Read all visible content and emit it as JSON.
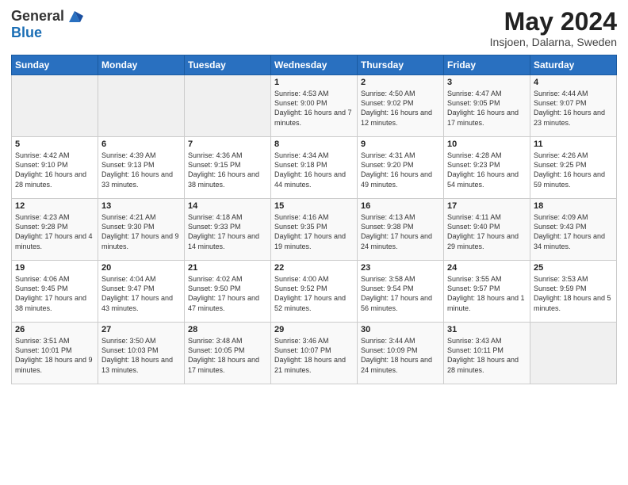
{
  "logo": {
    "line1": "General",
    "line2": "Blue"
  },
  "title": "May 2024",
  "subtitle": "Insjoen, Dalarna, Sweden",
  "weekdays": [
    "Sunday",
    "Monday",
    "Tuesday",
    "Wednesday",
    "Thursday",
    "Friday",
    "Saturday"
  ],
  "weeks": [
    [
      {
        "day": "",
        "info": ""
      },
      {
        "day": "",
        "info": ""
      },
      {
        "day": "",
        "info": ""
      },
      {
        "day": "1",
        "info": "Sunrise: 4:53 AM\nSunset: 9:00 PM\nDaylight: 16 hours\nand 7 minutes."
      },
      {
        "day": "2",
        "info": "Sunrise: 4:50 AM\nSunset: 9:02 PM\nDaylight: 16 hours\nand 12 minutes."
      },
      {
        "day": "3",
        "info": "Sunrise: 4:47 AM\nSunset: 9:05 PM\nDaylight: 16 hours\nand 17 minutes."
      },
      {
        "day": "4",
        "info": "Sunrise: 4:44 AM\nSunset: 9:07 PM\nDaylight: 16 hours\nand 23 minutes."
      }
    ],
    [
      {
        "day": "5",
        "info": "Sunrise: 4:42 AM\nSunset: 9:10 PM\nDaylight: 16 hours\nand 28 minutes."
      },
      {
        "day": "6",
        "info": "Sunrise: 4:39 AM\nSunset: 9:13 PM\nDaylight: 16 hours\nand 33 minutes."
      },
      {
        "day": "7",
        "info": "Sunrise: 4:36 AM\nSunset: 9:15 PM\nDaylight: 16 hours\nand 38 minutes."
      },
      {
        "day": "8",
        "info": "Sunrise: 4:34 AM\nSunset: 9:18 PM\nDaylight: 16 hours\nand 44 minutes."
      },
      {
        "day": "9",
        "info": "Sunrise: 4:31 AM\nSunset: 9:20 PM\nDaylight: 16 hours\nand 49 minutes."
      },
      {
        "day": "10",
        "info": "Sunrise: 4:28 AM\nSunset: 9:23 PM\nDaylight: 16 hours\nand 54 minutes."
      },
      {
        "day": "11",
        "info": "Sunrise: 4:26 AM\nSunset: 9:25 PM\nDaylight: 16 hours\nand 59 minutes."
      }
    ],
    [
      {
        "day": "12",
        "info": "Sunrise: 4:23 AM\nSunset: 9:28 PM\nDaylight: 17 hours\nand 4 minutes."
      },
      {
        "day": "13",
        "info": "Sunrise: 4:21 AM\nSunset: 9:30 PM\nDaylight: 17 hours\nand 9 minutes."
      },
      {
        "day": "14",
        "info": "Sunrise: 4:18 AM\nSunset: 9:33 PM\nDaylight: 17 hours\nand 14 minutes."
      },
      {
        "day": "15",
        "info": "Sunrise: 4:16 AM\nSunset: 9:35 PM\nDaylight: 17 hours\nand 19 minutes."
      },
      {
        "day": "16",
        "info": "Sunrise: 4:13 AM\nSunset: 9:38 PM\nDaylight: 17 hours\nand 24 minutes."
      },
      {
        "day": "17",
        "info": "Sunrise: 4:11 AM\nSunset: 9:40 PM\nDaylight: 17 hours\nand 29 minutes."
      },
      {
        "day": "18",
        "info": "Sunrise: 4:09 AM\nSunset: 9:43 PM\nDaylight: 17 hours\nand 34 minutes."
      }
    ],
    [
      {
        "day": "19",
        "info": "Sunrise: 4:06 AM\nSunset: 9:45 PM\nDaylight: 17 hours\nand 38 minutes."
      },
      {
        "day": "20",
        "info": "Sunrise: 4:04 AM\nSunset: 9:47 PM\nDaylight: 17 hours\nand 43 minutes."
      },
      {
        "day": "21",
        "info": "Sunrise: 4:02 AM\nSunset: 9:50 PM\nDaylight: 17 hours\nand 47 minutes."
      },
      {
        "day": "22",
        "info": "Sunrise: 4:00 AM\nSunset: 9:52 PM\nDaylight: 17 hours\nand 52 minutes."
      },
      {
        "day": "23",
        "info": "Sunrise: 3:58 AM\nSunset: 9:54 PM\nDaylight: 17 hours\nand 56 minutes."
      },
      {
        "day": "24",
        "info": "Sunrise: 3:55 AM\nSunset: 9:57 PM\nDaylight: 18 hours\nand 1 minute."
      },
      {
        "day": "25",
        "info": "Sunrise: 3:53 AM\nSunset: 9:59 PM\nDaylight: 18 hours\nand 5 minutes."
      }
    ],
    [
      {
        "day": "26",
        "info": "Sunrise: 3:51 AM\nSunset: 10:01 PM\nDaylight: 18 hours\nand 9 minutes."
      },
      {
        "day": "27",
        "info": "Sunrise: 3:50 AM\nSunset: 10:03 PM\nDaylight: 18 hours\nand 13 minutes."
      },
      {
        "day": "28",
        "info": "Sunrise: 3:48 AM\nSunset: 10:05 PM\nDaylight: 18 hours\nand 17 minutes."
      },
      {
        "day": "29",
        "info": "Sunrise: 3:46 AM\nSunset: 10:07 PM\nDaylight: 18 hours\nand 21 minutes."
      },
      {
        "day": "30",
        "info": "Sunrise: 3:44 AM\nSunset: 10:09 PM\nDaylight: 18 hours\nand 24 minutes."
      },
      {
        "day": "31",
        "info": "Sunrise: 3:43 AM\nSunset: 10:11 PM\nDaylight: 18 hours\nand 28 minutes."
      },
      {
        "day": "",
        "info": ""
      }
    ]
  ]
}
